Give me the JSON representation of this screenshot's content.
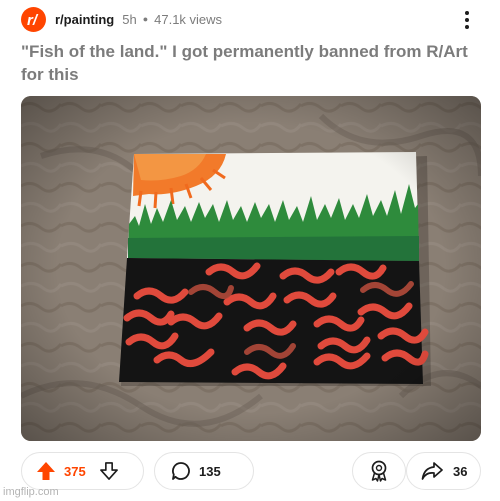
{
  "post": {
    "subreddit": "r/painting",
    "age": "5h",
    "views": "47.1k views",
    "title": "\"Fish of the land.\" I got permanently banned from R/Art for this"
  },
  "actions": {
    "upvotes": "375",
    "comments": "135",
    "shares": "36"
  },
  "watermark": "imgflip.com",
  "colors": {
    "accent": "#ff4500",
    "muted_text": "#7c7c7c"
  },
  "icons": [
    "subreddit-icon",
    "more-options-icon",
    "upvote-icon",
    "downvote-icon",
    "comment-icon",
    "award-icon",
    "share-icon"
  ]
}
